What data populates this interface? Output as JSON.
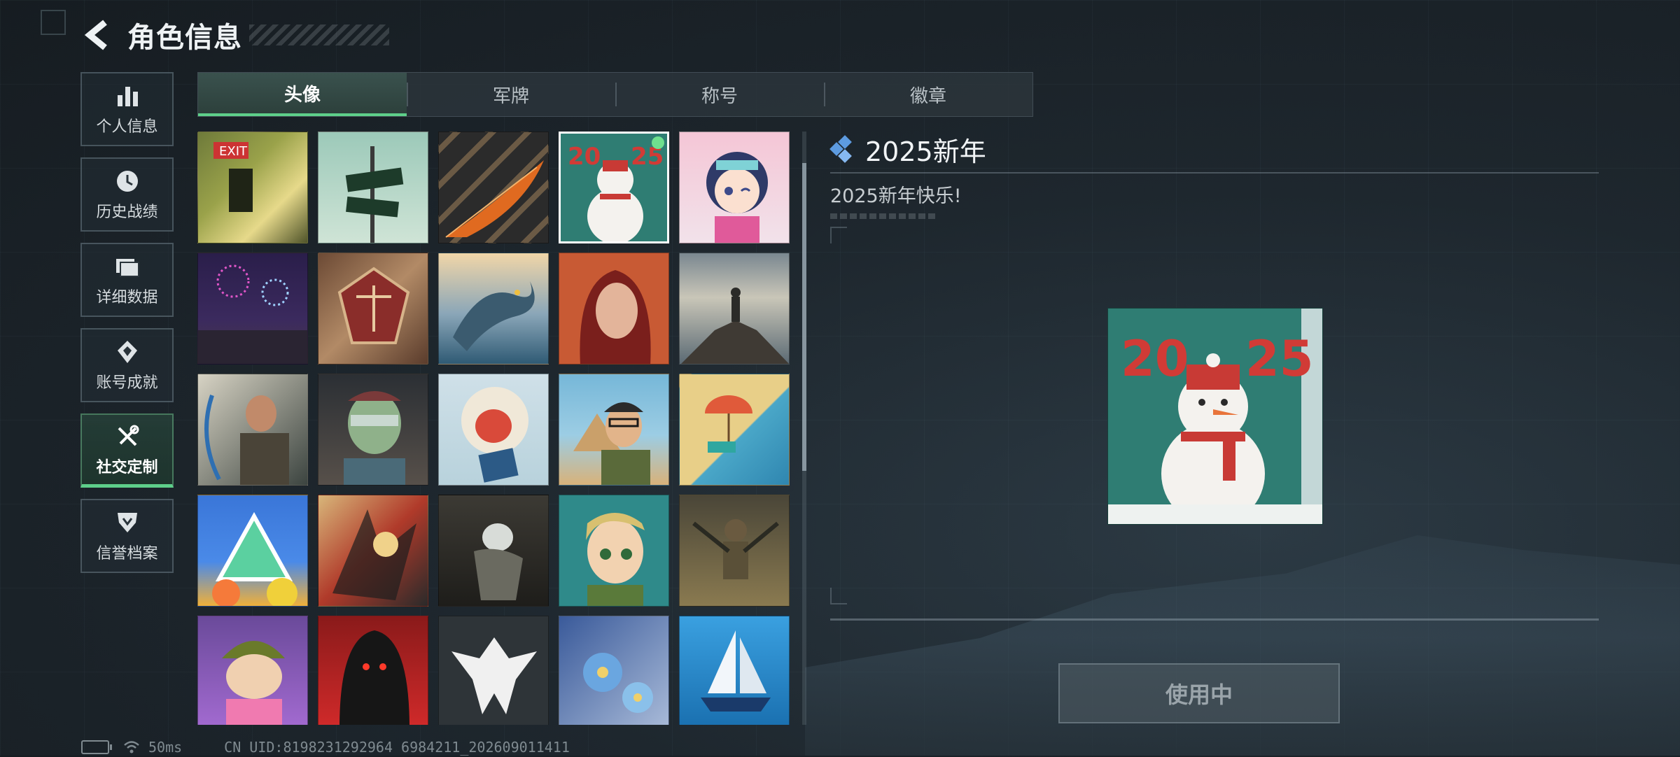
{
  "header": {
    "title": "角色信息",
    "back_icon": "back-arrow-icon"
  },
  "sidebar": {
    "items": [
      {
        "label": "个人信息",
        "icon": "bar-chart-icon",
        "active": false
      },
      {
        "label": "历史战绩",
        "icon": "history-clock-icon",
        "active": false
      },
      {
        "label": "详细数据",
        "icon": "folder-data-icon",
        "active": false
      },
      {
        "label": "账号成就",
        "icon": "achievement-icon",
        "active": false
      },
      {
        "label": "社交定制",
        "icon": "tools-icon",
        "active": true
      },
      {
        "label": "信誉档案",
        "icon": "reputation-icon",
        "active": false
      }
    ]
  },
  "tabs": [
    {
      "label": "头像",
      "active": true
    },
    {
      "label": "军牌",
      "active": false
    },
    {
      "label": "称号",
      "active": false
    },
    {
      "label": "徽章",
      "active": false
    }
  ],
  "avatars": [
    {
      "name": "exit",
      "selected": false
    },
    {
      "name": "way-out-sign",
      "selected": false
    },
    {
      "name": "feather",
      "selected": false
    },
    {
      "name": "2025-snowman",
      "selected": true
    },
    {
      "name": "anime-girl",
      "selected": false
    },
    {
      "name": "fireworks",
      "selected": false
    },
    {
      "name": "scales-emblem",
      "selected": false
    },
    {
      "name": "dragon",
      "selected": false
    },
    {
      "name": "red-hair-woman",
      "selected": false
    },
    {
      "name": "mountain-soldier",
      "selected": false
    },
    {
      "name": "archer",
      "selected": false
    },
    {
      "name": "zombie",
      "selected": false
    },
    {
      "name": "monkey-reading",
      "selected": false
    },
    {
      "name": "pyramid-man",
      "selected": false
    },
    {
      "name": "beach",
      "selected": false
    },
    {
      "name": "triangle-art",
      "selected": false
    },
    {
      "name": "red-gold-art",
      "selected": false
    },
    {
      "name": "crouching-figure",
      "selected": false
    },
    {
      "name": "cartoon-boy",
      "selected": false
    },
    {
      "name": "desert-soldier",
      "selected": false
    },
    {
      "name": "helmet-cartoon",
      "selected": false
    },
    {
      "name": "hooded-figure",
      "selected": false
    },
    {
      "name": "eagle-emblem",
      "selected": false
    },
    {
      "name": "blue-flowers",
      "selected": false
    },
    {
      "name": "sailboat",
      "selected": false
    }
  ],
  "detail": {
    "name": "2025新年",
    "description": "2025新年快乐!",
    "button_label": "使用中"
  },
  "status": {
    "ping": "50ms",
    "uid": "CN UID:8198231292964 6984211_202609011411"
  }
}
